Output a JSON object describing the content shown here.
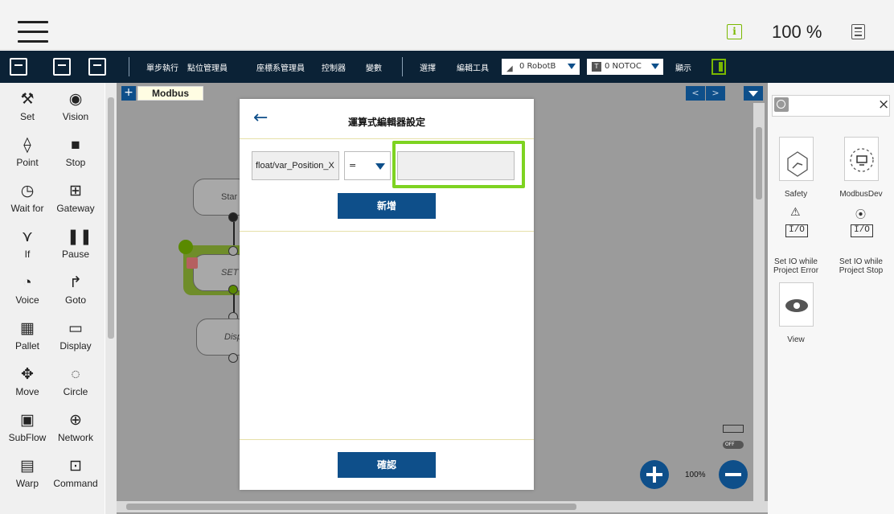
{
  "topbar": {
    "zoom": "100 %"
  },
  "toolbar": {
    "items": [
      "單步執行",
      "點位管理員",
      "座標系管理員",
      "控制器",
      "變數",
      "選擇",
      "編輯工具"
    ],
    "robot_dropdown": "0 RobotB",
    "tool_dropdown": "0 NOTOC",
    "tool_badge": "T",
    "display_label": "顯示"
  },
  "palette": {
    "items": [
      {
        "label": "Set",
        "icon": "wrench-icon"
      },
      {
        "label": "Vision",
        "icon": "eye-icon"
      },
      {
        "label": "Point",
        "icon": "robot-arm-icon"
      },
      {
        "label": "Stop",
        "icon": "stop-icon"
      },
      {
        "label": "Wait for",
        "icon": "clock-icon"
      },
      {
        "label": "Gateway",
        "icon": "hierarchy-icon"
      },
      {
        "label": "If",
        "icon": "branch-icon"
      },
      {
        "label": "Pause",
        "icon": "pause-icon"
      },
      {
        "label": "Voice",
        "icon": "speaker-icon"
      },
      {
        "label": "Goto",
        "icon": "goto-arrow-icon"
      },
      {
        "label": "Pallet",
        "icon": "grid-icon"
      },
      {
        "label": "Display",
        "icon": "monitor-icon"
      },
      {
        "label": "Move",
        "icon": "move-arrows-icon"
      },
      {
        "label": "Circle",
        "icon": "circle-dashed-icon"
      },
      {
        "label": "SubFlow",
        "icon": "subflow-icon"
      },
      {
        "label": "Network",
        "icon": "globe-icon"
      },
      {
        "label": "Warp",
        "icon": "warp-icon"
      },
      {
        "label": "Command",
        "icon": "command-icon"
      }
    ]
  },
  "canvas": {
    "tab_add": "+",
    "tab_name": "Modbus",
    "nav_prev": "<",
    "nav_next": ">",
    "nodes": {
      "start": "Star",
      "set": "SET",
      "display": "Displ"
    },
    "zoom_label": "100%",
    "toggle_label": "OFF"
  },
  "right_panel": {
    "search_placeholder": "",
    "tiles": [
      {
        "label": "Safety",
        "icon": "safety-cube-icon"
      },
      {
        "label": "ModbusDev",
        "icon": "modbus-device-icon"
      },
      {
        "label": "Set IO while Project Error",
        "icon": "io-warning-icon"
      },
      {
        "label": "Set IO while Project Stop",
        "icon": "io-stop-icon"
      },
      {
        "label": "View",
        "icon": "eye-icon"
      }
    ],
    "io_text": "I/O"
  },
  "modal": {
    "title": "運算式編輯器設定",
    "variable": "float/var_Position_X",
    "operator": "=",
    "value_input": "",
    "add_button": "新增",
    "confirm_button": "確認",
    "accent_highlight": "#7ed321"
  }
}
